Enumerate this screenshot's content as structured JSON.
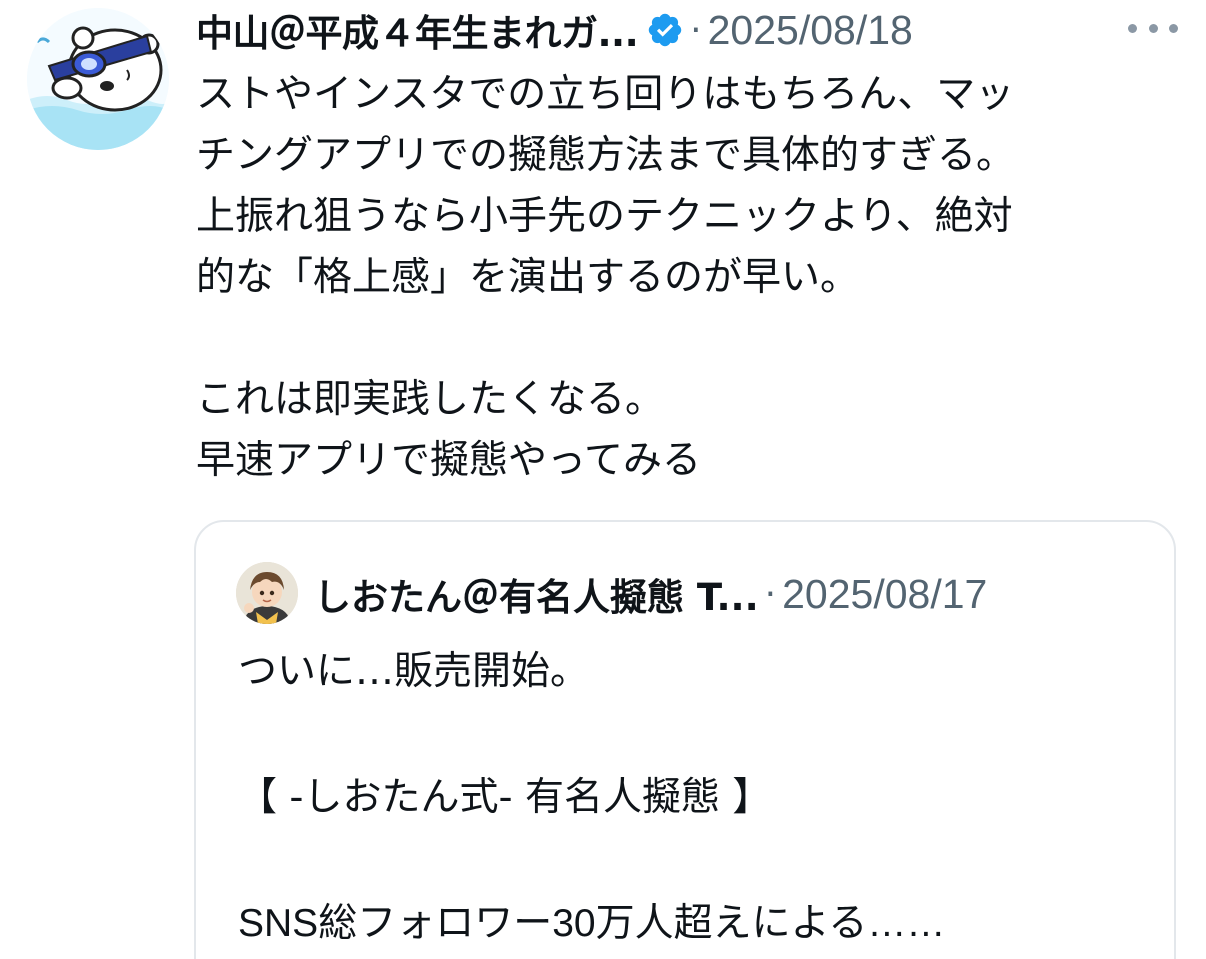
{
  "tweet": {
    "author": {
      "name": "中山＠平成４年生まれガ...",
      "verified": true,
      "avatar_icon": "swimmer-bear-avatar"
    },
    "date": "2025/08/18",
    "separator": "·",
    "lines": [
      "ストやインスタでの立ち回りはもちろん、マッ",
      "チングアプリでの擬態方法まで具体的すぎる。",
      "上振れ狙うなら小手先のテクニックより、絶対",
      "的な「格上感」を演出するのが早い。",
      "",
      "これは即実践したくなる。",
      "早速アプリで擬態やってみる"
    ]
  },
  "quoted_tweet": {
    "author": {
      "name": "しおたん＠有名人擬態 T...",
      "avatar_icon": "boy-character-avatar"
    },
    "date": "2025/08/17",
    "separator": "·",
    "lines": [
      "ついに…販売開始。",
      "",
      "【 -しおたん式- 有名人擬態 】",
      "",
      "SNS総フォロワー30万人超えによる……"
    ]
  },
  "colors": {
    "text": "#0f1419",
    "muted": "#536471",
    "verified_blue": "#1d9bf0",
    "border": "#e3e7eb"
  },
  "icons": {
    "verified": "verified-badge-icon",
    "more": "more-options-icon"
  }
}
